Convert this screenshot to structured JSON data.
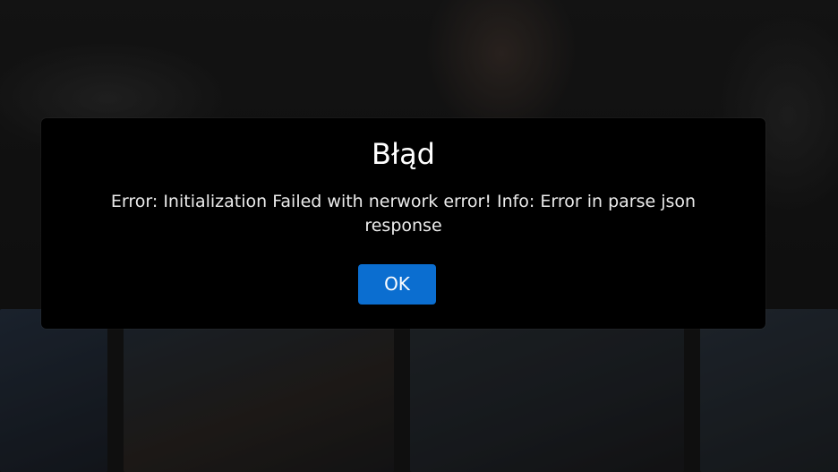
{
  "dialog": {
    "title": "Błąd",
    "message": "Error: Initialization Failed with nerwork error! Info: Error in parse json response",
    "ok_label": "OK"
  },
  "colors": {
    "dialog_background": "#000000",
    "button_background": "#0b6ed0",
    "text": "#ffffff"
  }
}
